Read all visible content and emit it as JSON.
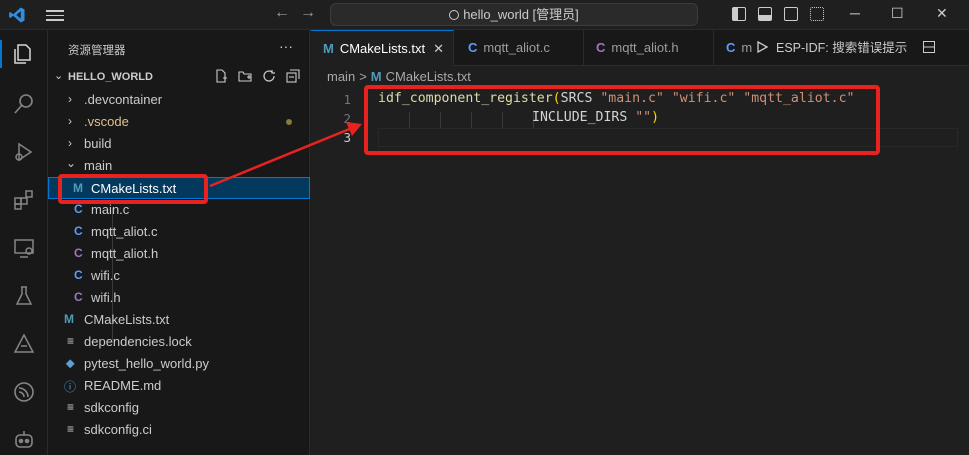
{
  "titlebar": {
    "search_text": "hello_world [管理员]",
    "nav_back": "←",
    "nav_forward": "→",
    "minimize": "─",
    "maximize": "☐",
    "close": "✕"
  },
  "activitybar": {
    "icons": [
      "explorer-icon",
      "search-icon",
      "run-debug-icon",
      "extensions-icon",
      "remote-explorer-icon",
      "testing-icon",
      "idf-icon",
      "espressif-icon",
      "copilot-icon"
    ]
  },
  "sidebar": {
    "title": "资源管理器",
    "more": "···",
    "section_label": "HELLO_WORLD",
    "tree": [
      {
        "label": ".devcontainer",
        "kind": "folder",
        "expanded": false
      },
      {
        "label": ".vscode",
        "kind": "folder",
        "expanded": false,
        "modified": true
      },
      {
        "label": "build",
        "kind": "folder",
        "expanded": false
      },
      {
        "label": "main",
        "kind": "folder",
        "expanded": true
      },
      {
        "label": "CMakeLists.txt",
        "kind": "cmake",
        "icon": "M",
        "selected": true
      },
      {
        "label": "main.c",
        "kind": "c",
        "icon": "C"
      },
      {
        "label": "mqtt_aliot.c",
        "kind": "c",
        "icon": "C"
      },
      {
        "label": "mqtt_aliot.h",
        "kind": "h",
        "icon": "C"
      },
      {
        "label": "wifi.c",
        "kind": "c",
        "icon": "C"
      },
      {
        "label": "wifi.h",
        "kind": "h",
        "icon": "C"
      },
      {
        "label": "CMakeLists.txt",
        "kind": "cmake",
        "icon": "M"
      },
      {
        "label": "dependencies.lock",
        "kind": "lines",
        "icon": "≡"
      },
      {
        "label": "pytest_hello_world.py",
        "kind": "python",
        "icon": "⬥"
      },
      {
        "label": "README.md",
        "kind": "info",
        "icon": "ⓘ"
      },
      {
        "label": "sdkconfig",
        "kind": "lines",
        "icon": "≡"
      },
      {
        "label": "sdkconfig.ci",
        "kind": "lines",
        "icon": "≡"
      }
    ]
  },
  "tabs": [
    {
      "label": "CMakeLists.txt",
      "icon": "M",
      "active": true,
      "close": "✕"
    },
    {
      "label": "mqtt_aliot.c",
      "icon": "C"
    },
    {
      "label": "mqtt_aliot.h",
      "icon": "C"
    },
    {
      "label": "m",
      "icon": "C"
    }
  ],
  "editor_actions": {
    "esp_idf": "ESP-IDF:  搜索错误提示"
  },
  "breadcrumb": {
    "folder": "main",
    "sep": ">",
    "file_icon": "M",
    "file": "CMakeLists.txt"
  },
  "code": {
    "line_numbers": [
      "1",
      "2",
      "3"
    ],
    "line1": {
      "fn": "idf_component_register",
      "open": "(",
      "text": "SRCS ",
      "s1": "\"main.c\"",
      "s2": "\"wifi.c\"",
      "s3": "\"mqtt_aliot.c\""
    },
    "line2": {
      "text": "INCLUDE_DIRS ",
      "s1": "\"\"",
      "close": ")"
    }
  },
  "colors": {
    "accent": "#0078d4",
    "annotation_red": "#e8231f",
    "cmake_icon": "#519aba",
    "c_icon": "#599eff",
    "h_icon": "#a074c4",
    "folder_vscode": "#e2c08d"
  }
}
